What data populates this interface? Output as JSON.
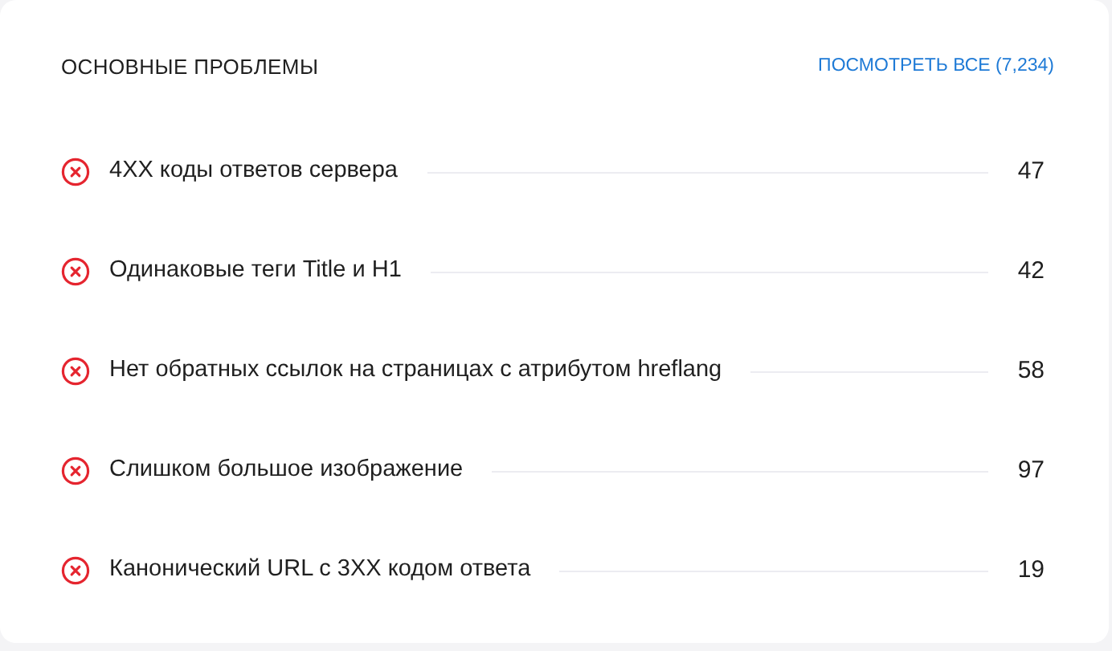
{
  "title": "ОСНОВНЫЕ ПРОБЛЕМЫ",
  "view_all_link": "ПОСМОТРЕТЬ ВСЕ (7,234)",
  "issues": [
    {
      "label": "4XX коды ответов сервера",
      "count": "47"
    },
    {
      "label": "Одинаковые теги Title и H1",
      "count": "42"
    },
    {
      "label": "Нет обратных ссылок на страницах с атрибутом hreflang",
      "count": "58"
    },
    {
      "label": "Слишком большое изображение",
      "count": "97"
    },
    {
      "label": "Канонический URL с 3XX кодом ответа",
      "count": "19"
    }
  ]
}
